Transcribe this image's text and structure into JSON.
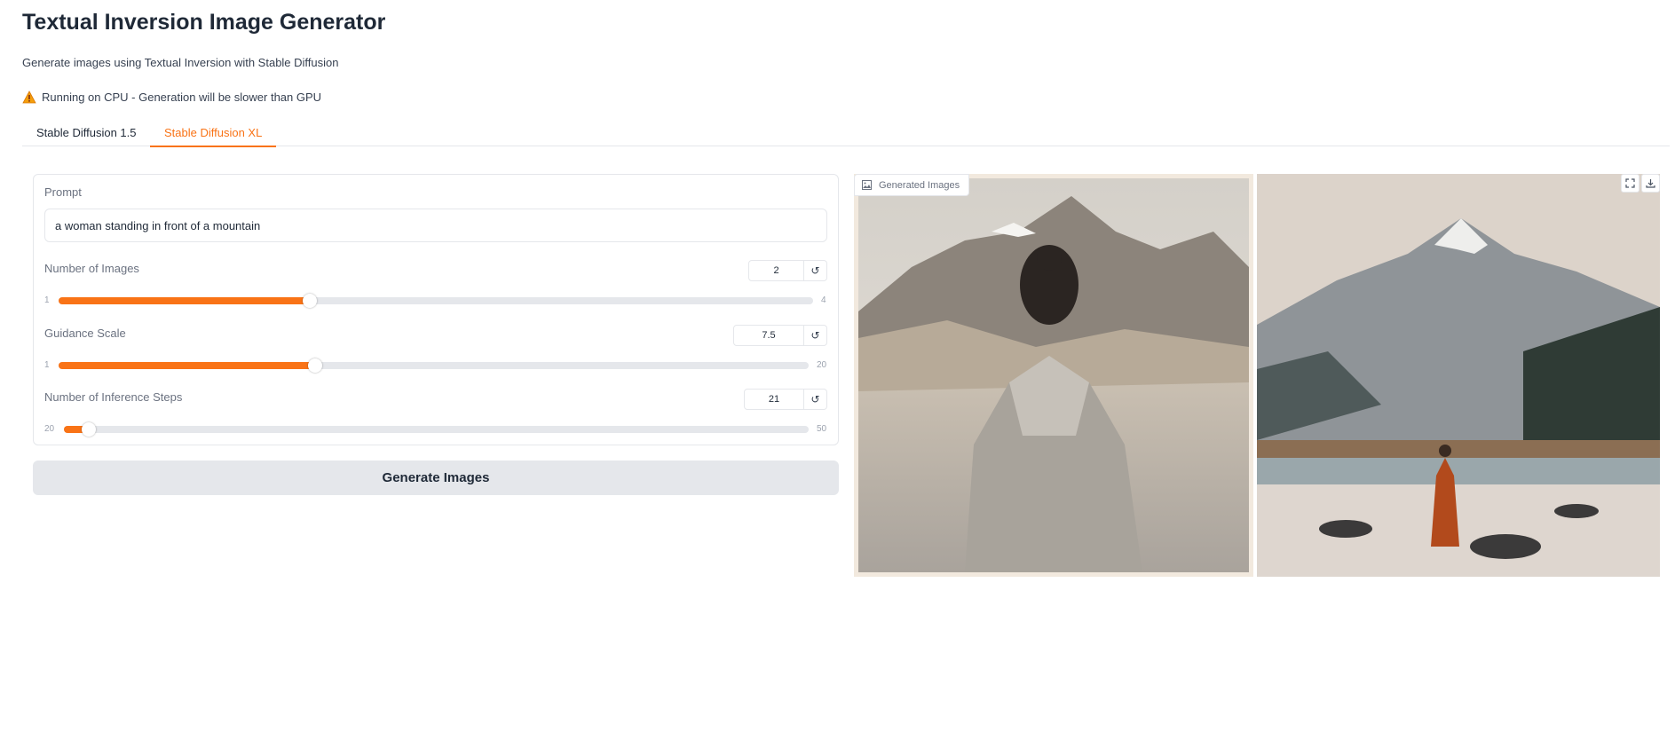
{
  "app": {
    "title": "Textual Inversion Image Generator",
    "subtitle": "Generate images using Textual Inversion with Stable Diffusion",
    "warning": "Running on CPU - Generation will be slower than GPU"
  },
  "tabs": [
    {
      "label": "Stable Diffusion 1.5",
      "active": false
    },
    {
      "label": "Stable Diffusion XL",
      "active": true
    }
  ],
  "form": {
    "prompt_label": "Prompt",
    "prompt_value": "a woman standing in front of a mountain",
    "num_images": {
      "label": "Number of Images",
      "value": "2",
      "min": "1",
      "max": "4",
      "fraction": 0.333
    },
    "guidance": {
      "label": "Guidance Scale",
      "value": "7.5",
      "min": "1",
      "max": "20",
      "fraction": 0.342
    },
    "steps": {
      "label": "Number of Inference Steps",
      "value": "21",
      "min": "20",
      "max": "50",
      "fraction": 0.033
    },
    "reset_icon": "↺"
  },
  "generate_label": "Generate Images",
  "gallery": {
    "label": "Generated Images",
    "icons": [
      "image-icon",
      "fullscreen-icon",
      "download-icon"
    ]
  },
  "colors": {
    "accent": "#f97316",
    "button_bg": "#e5e7eb",
    "warning": "#f59e0b"
  }
}
